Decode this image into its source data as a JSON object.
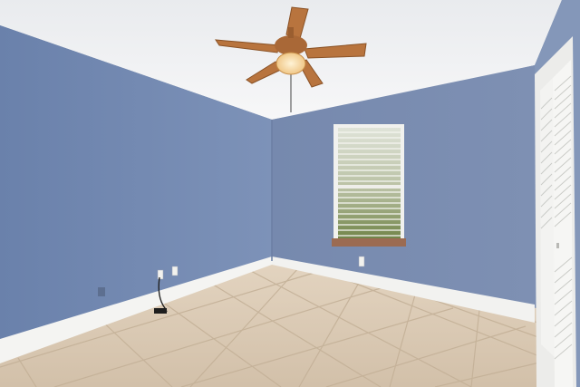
{
  "scene": {
    "description_label": "",
    "colors": {
      "ceiling": "#f2f3f5",
      "wall_left": "#6f86b0",
      "wall_back": "#7c8fb4",
      "wall_right": "#8396b8",
      "baseboard": "#f4f4f2",
      "floor": "#d9c8b3",
      "grout": "#bca98f",
      "fan_blade": "#b8743e",
      "fan_light": "#f6d9a8",
      "window_frame": "#f1f1ee",
      "blind": "#e9ebe6",
      "foliage": "#7c8f52",
      "closet_door": "#f3f3f1"
    },
    "objects": [
      "ceiling-fan",
      "window-with-blinds",
      "louvered-closet-door",
      "electrical-outlets",
      "cable"
    ]
  }
}
